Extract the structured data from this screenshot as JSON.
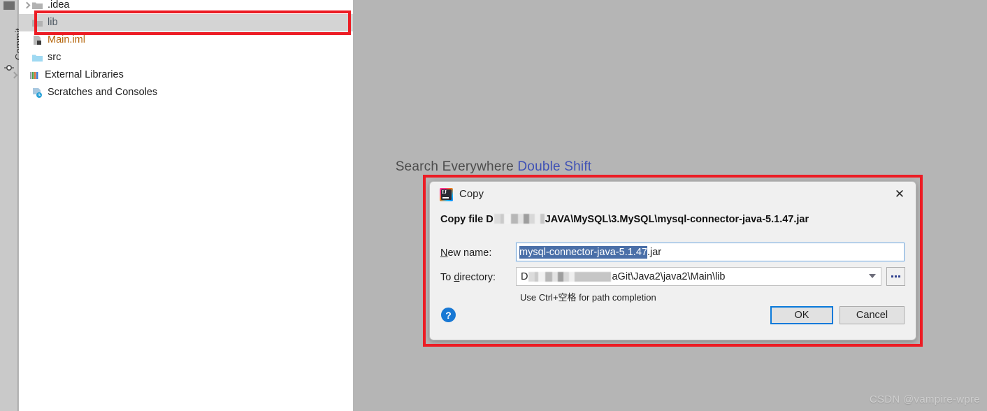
{
  "app": {
    "tool_strip": {
      "commit_label": "Commit",
      "commit_icon": "commit-node-icon"
    }
  },
  "project_tree": {
    "items": [
      {
        "label": ".idea",
        "icon": "folder-grey-icon",
        "expandable": true,
        "selected": false,
        "style": "normal"
      },
      {
        "label": "lib",
        "icon": "folder-grey-icon",
        "expandable": false,
        "selected": true,
        "style": "selected"
      },
      {
        "label": "Main.iml",
        "icon": "iml-file-icon",
        "expandable": false,
        "selected": false,
        "style": "orange"
      },
      {
        "label": "src",
        "icon": "folder-source-icon",
        "expandable": false,
        "selected": false,
        "style": "normal"
      },
      {
        "label": "External Libraries",
        "icon": "libraries-bars-icon",
        "expandable": true,
        "selected": false,
        "style": "normal"
      },
      {
        "label": "Scratches and Consoles",
        "icon": "scratches-icon",
        "expandable": false,
        "selected": false,
        "style": "normal"
      }
    ]
  },
  "editor": {
    "search_hint_text": "Search Everywhere",
    "search_hint_shortcut": "Double Shift"
  },
  "watermark": {
    "text": "CSDN @vampire-wpre"
  },
  "dialog": {
    "title": "Copy",
    "app_icon": "intellij-idea-icon",
    "close_icon": "close-icon",
    "headline_prefix": "Copy file D",
    "headline_suffix": "JAVA\\MySQL\\3.MySQL\\mysql-connector-java-5.1.47.jar",
    "new_name": {
      "label_pre": "N",
      "label_post": "ew name:",
      "value_selected": "mysql-connector-java-5.1.47",
      "value_rest": ".jar"
    },
    "to_directory": {
      "label_pre": "To ",
      "label_mid": "d",
      "label_post": "irectory:",
      "value_prefix": "D",
      "value_suffix": "aGit\\Java2\\java2\\Main\\lib",
      "dropdown_icon": "chevron-down-icon",
      "browse_label": "...",
      "browse_icon": "ellipsis-icon"
    },
    "hint": "Use Ctrl+空格 for path completion",
    "help_icon": "help-question-icon",
    "help_glyph": "?",
    "ok_label": "OK",
    "cancel_label": "Cancel"
  },
  "annotations": {
    "color": "#ec1c24",
    "boxes": [
      "lib-row-highlight",
      "copy-dialog-highlight"
    ]
  }
}
